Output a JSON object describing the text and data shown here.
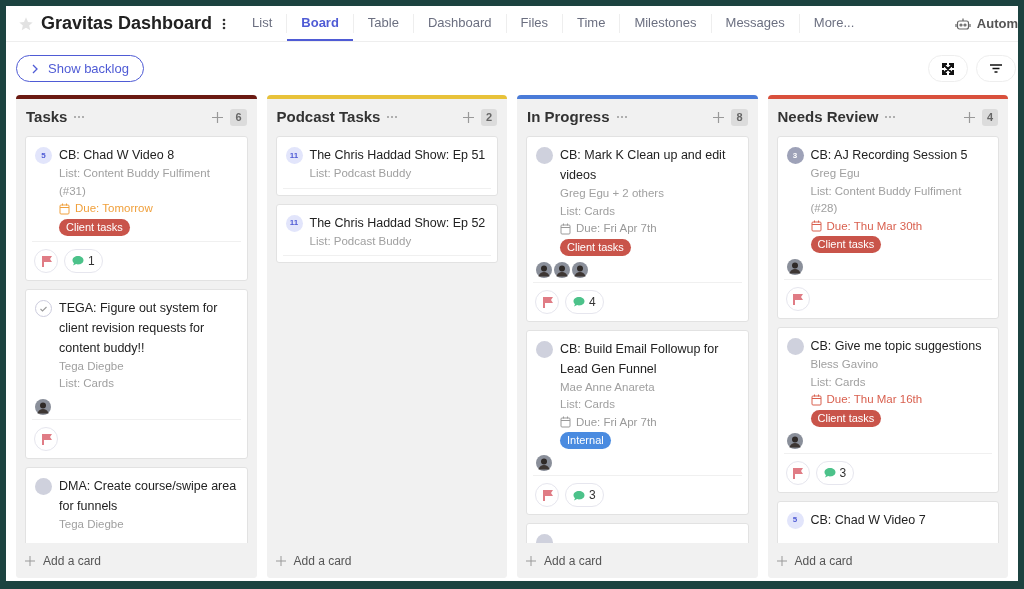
{
  "header": {
    "title": "Gravitas Dashboard",
    "tabs": [
      {
        "label": "List",
        "selected": false
      },
      {
        "label": "Board",
        "selected": true
      },
      {
        "label": "Table",
        "selected": false
      },
      {
        "label": "Dashboard",
        "selected": false
      },
      {
        "label": "Files",
        "selected": false
      },
      {
        "label": "Time",
        "selected": false
      },
      {
        "label": "Milestones",
        "selected": false
      },
      {
        "label": "Messages",
        "selected": false
      },
      {
        "label": "More...",
        "selected": false
      }
    ],
    "automation_label": "Autom"
  },
  "toolbar": {
    "backlog_button": "Show backlog"
  },
  "columns": [
    {
      "title": "Tasks",
      "color": "#6b1a12",
      "count": "6",
      "add_card": "Add a card",
      "cards": [
        {
          "badge": {
            "kind": "number",
            "text": "5"
          },
          "title": "CB: Chad W Video 8",
          "meta": [
            "List: Content Buddy Fulfiment (#31)"
          ],
          "due": {
            "text": "Due: Tomorrow",
            "color": "#f0a03c"
          },
          "tags": [
            {
              "label": "Client tasks",
              "color": "#c9544a"
            }
          ],
          "footer": {
            "flag": true,
            "comments": "1"
          }
        },
        {
          "badge": {
            "kind": "done"
          },
          "title": "TEGA: Figure out system for client revision requests for content buddy!!",
          "meta": [
            "Tega Diegbe",
            "List: Cards"
          ],
          "avatars": [
            {
              "kind": "picture"
            }
          ],
          "footer": {
            "flag": true
          }
        },
        {
          "badge": {
            "kind": "blank"
          },
          "title": "DMA: Create course/swipe area for funnels",
          "meta": [
            "Tega Diegbe"
          ]
        }
      ]
    },
    {
      "title": "Podcast Tasks",
      "color": "#e8c23a",
      "count": "2",
      "add_card": "Add a card",
      "cards": [
        {
          "badge": {
            "kind": "number",
            "text": "11"
          },
          "title": "The Chris Haddad Show: Ep 51",
          "meta": [
            "List: Podcast Buddy"
          ],
          "footer": {
            "flag": false
          }
        },
        {
          "badge": {
            "kind": "number",
            "text": "11"
          },
          "title": "The Chris Haddad Show: Ep 52",
          "meta": [
            "List: Podcast Buddy"
          ],
          "footer": {
            "flag": false
          }
        }
      ]
    },
    {
      "title": "In Progress",
      "color": "#4a7bd8",
      "count": "8",
      "add_card": "Add a card",
      "cards": [
        {
          "badge": {
            "kind": "blank"
          },
          "title": "CB: Mark K Clean up and edit videos",
          "meta": [
            "Greg Egu + 2 others",
            "List: Cards"
          ],
          "due": {
            "text": "Due: Fri Apr 7th",
            "color": "#9a9a9a"
          },
          "tags": [
            {
              "label": "Client tasks",
              "color": "#c9544a"
            }
          ],
          "avatars": [
            {
              "kind": "picture"
            },
            {
              "kind": "picture"
            },
            {
              "kind": "picture"
            }
          ],
          "footer": {
            "flag": true,
            "comments": "4"
          }
        },
        {
          "badge": {
            "kind": "blank"
          },
          "title": "CB: Build Email Followup for Lead Gen Funnel",
          "meta": [
            "Mae Anne Anareta",
            "List: Cards"
          ],
          "due": {
            "text": "Due: Fri Apr 7th",
            "color": "#9a9a9a"
          },
          "tags": [
            {
              "label": "Internal",
              "color": "#4a8be0"
            }
          ],
          "avatars": [
            {
              "kind": "picture"
            }
          ],
          "footer": {
            "flag": true,
            "comments": "3"
          }
        },
        {
          "badge": {
            "kind": "blank"
          }
        }
      ]
    },
    {
      "title": "Needs Review",
      "color": "#d9503c",
      "count": "4",
      "add_card": "Add a card",
      "cards": [
        {
          "badge": {
            "kind": "number_muted",
            "text": "3"
          },
          "title": "CB: AJ Recording Session 5",
          "meta": [
            "Greg Egu",
            "List: Content Buddy Fulfiment (#28)"
          ],
          "due": {
            "text": "Due: Thu Mar 30th",
            "color": "#d9604f"
          },
          "tags": [
            {
              "label": "Client tasks",
              "color": "#c9544a"
            }
          ],
          "avatars": [
            {
              "kind": "picture"
            }
          ],
          "footer": {
            "flag": true
          }
        },
        {
          "badge": {
            "kind": "blank"
          },
          "title": "CB: Give me topic suggestions",
          "meta": [
            "Bless Gavino",
            "List: Cards"
          ],
          "due": {
            "text": "Due: Thu Mar 16th",
            "color": "#d9604f"
          },
          "tags": [
            {
              "label": "Client tasks",
              "color": "#c9544a"
            }
          ],
          "avatars": [
            {
              "kind": "picture"
            }
          ],
          "footer": {
            "flag": true,
            "comments": "3"
          }
        },
        {
          "badge": {
            "kind": "number",
            "text": "5"
          },
          "title": "CB: Chad W Video 7"
        }
      ]
    }
  ]
}
